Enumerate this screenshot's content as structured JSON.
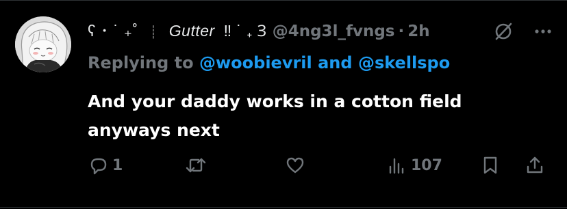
{
  "author": {
    "display_name_prefix": "ʕ ･ ˙ ₊˚",
    "display_name_sep": "┊",
    "display_name_main": "Gutter",
    "display_name_suffix": "‼ ˙ ₊ Ɜ",
    "handle": "@4ng3l_fvngs",
    "time": "2h"
  },
  "reply": {
    "prefix": "Replying to",
    "user1": "@woobievril",
    "conjunction": "and",
    "user2": "@skellspo"
  },
  "body": {
    "text": "And your daddy works in a cotton field\nanyways next"
  },
  "stats": {
    "replies": "1",
    "retweets": "",
    "likes": "",
    "views": "107"
  },
  "colors": {
    "background": "#000000",
    "text": "#ffffff",
    "muted": "#71767b",
    "accent": "#1d9bf0"
  },
  "icons": {
    "grok": "slashed-circle-icon",
    "more": "more-icon",
    "reply": "reply-icon",
    "retweet": "retweet-icon",
    "like": "heart-icon",
    "views": "views-icon",
    "bookmark": "bookmark-icon",
    "share": "share-icon"
  }
}
